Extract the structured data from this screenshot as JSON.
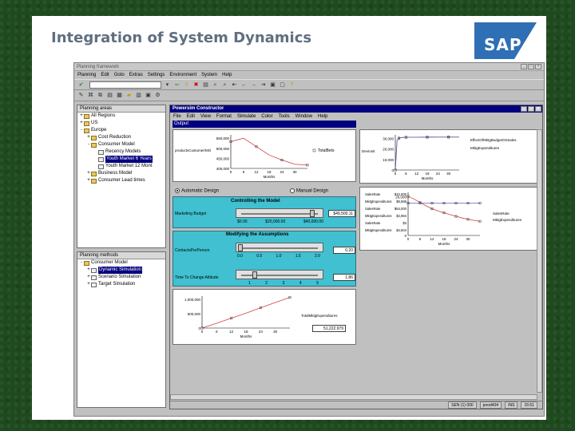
{
  "slide": {
    "title": "Integration of System Dynamics",
    "logo_text": "SAP",
    "colors": {
      "background": "#1f4a1f",
      "logo_blue": "#2f6fb5",
      "title_gray": "#5f6f7f"
    }
  },
  "app": {
    "window_title": "Planning framework",
    "menu": [
      "Planning",
      "Edit",
      "Goto",
      "Extras",
      "Settings",
      "Environment",
      "System",
      "Help"
    ],
    "left_top": {
      "header": "Planning areas",
      "items": [
        {
          "label": "All Regions",
          "level": 0,
          "exp": "+",
          "icon": "folder"
        },
        {
          "label": "US",
          "level": 0,
          "exp": "+",
          "icon": "folder"
        },
        {
          "label": "Europe",
          "level": 0,
          "exp": "-",
          "icon": "folder"
        },
        {
          "label": "Cost Reduction",
          "level": 1,
          "exp": "+",
          "icon": "folder"
        },
        {
          "label": "Consumer Model",
          "level": 1,
          "exp": "-",
          "icon": "folder"
        },
        {
          "label": "Recency Models",
          "level": 2,
          "exp": "",
          "icon": "doc"
        },
        {
          "label": "Youth Market 6 Years",
          "level": 2,
          "exp": "",
          "icon": "doc",
          "selected": true
        },
        {
          "label": "Youth Market 12 Mont",
          "level": 2,
          "exp": "",
          "icon": "doc"
        },
        {
          "label": "Business Model",
          "level": 1,
          "exp": "+",
          "icon": "folder"
        },
        {
          "label": "Consumer Lead times",
          "level": 1,
          "exp": "+",
          "icon": "folder"
        }
      ]
    },
    "left_bottom": {
      "header": "Planning methods",
      "items": [
        {
          "label": "Consumer Model",
          "level": 0,
          "exp": "-",
          "icon": "folder"
        },
        {
          "label": "Dynamic Simulation",
          "level": 1,
          "exp": "+",
          "icon": "doc",
          "selected": true
        },
        {
          "label": "Scenario Simulation",
          "level": 1,
          "exp": "+",
          "icon": "doc"
        },
        {
          "label": "Target Simulation",
          "level": 1,
          "exp": "+",
          "icon": "doc"
        }
      ]
    },
    "inner": {
      "title": "Powersim Constructor",
      "menu": [
        "File",
        "Edit",
        "View",
        "Format",
        "Simulate",
        "Color",
        "Tools",
        "Window",
        "Help"
      ],
      "output_label": "Output",
      "radio_auto": "Automatic Design",
      "radio_manual": "Manual Design",
      "controlling_title": "Controlling the Model",
      "control_param_label": "Marketing Budget",
      "control_ticks": [
        "$0.00",
        "$20,000.00",
        "$40,000.00"
      ],
      "control_value": "$49,500.11",
      "assumptions_title": "Modifying the Assumptions",
      "assump1_label": "ContactsPerPerson",
      "assump1_ticks": [
        "0.0",
        "0.5",
        "1.0",
        "1.5",
        "2.0"
      ],
      "assump1_value": "0.20",
      "assump2_label": "Time To Change Attitude",
      "assump2_ticks": [
        "1",
        "2",
        "3",
        "4",
        "5"
      ],
      "assump2_value": "1.86",
      "bottom_chart_value": "51,222.979"
    },
    "statusbar": [
      "SEN (1) 000",
      "pnod404",
      "INS",
      "15:51"
    ]
  },
  "chart_data": [
    {
      "type": "line",
      "title": "",
      "xlabel": "Months",
      "ylabel": "productsCustomer/MO",
      "x": [
        0,
        6,
        12,
        18,
        24,
        30,
        36
      ],
      "series": [
        {
          "name": "TotalBets",
          "values": [
            540000,
            560000,
            510000,
            460000,
            430000,
            405000,
            400000
          ]
        }
      ],
      "y_ticks": [
        "400,000",
        "450,000",
        "500,000",
        "550,000"
      ],
      "x_ticks": [
        "0",
        "6",
        "12",
        "18",
        "24",
        "30"
      ],
      "ylim": [
        380000,
        580000
      ]
    },
    {
      "type": "line",
      "title": "",
      "xlabel": "Months",
      "ylabel": "Dev/unit",
      "x": [
        0,
        1,
        2,
        3,
        6,
        12,
        18,
        24,
        30,
        36
      ],
      "series": [
        {
          "name": "EffectOfMktgBudgetOnSales",
          "values": [
            0,
            27000,
            29000,
            29500,
            29800,
            29900,
            29950,
            30000,
            30000,
            30000
          ]
        },
        {
          "name": "MktgExpenditures",
          "values": [
            0,
            27000,
            29000,
            29500,
            29800,
            29900,
            29950,
            30000,
            30000,
            30000
          ]
        }
      ],
      "y_ticks": [
        "0",
        "10,000",
        "20,000",
        "30,000"
      ],
      "x_ticks": [
        "0",
        "6",
        "12",
        "18",
        "24",
        "30"
      ],
      "ylim": [
        0,
        32000
      ]
    },
    {
      "type": "line",
      "title": "",
      "xlabel": "Months",
      "ylabel": "",
      "x": [
        0,
        3,
        6,
        9,
        12,
        15,
        18,
        21,
        24,
        27,
        30,
        33,
        36
      ],
      "series": [
        {
          "name": "SalesRate",
          "values": [
            29000,
            27000,
            24500,
            22000,
            19800,
            18200,
            16800,
            15500,
            14200,
            13000,
            12000,
            11200,
            10500
          ]
        },
        {
          "name": "MktgExpenditures",
          "values": [
            24000,
            24000,
            24000,
            24000,
            24000,
            24000,
            24000,
            24000,
            24000,
            24000,
            24000,
            24000,
            24000
          ]
        }
      ],
      "y_ticks": [
        "0",
        "20,000"
      ],
      "x_ticks": [
        "0",
        "6",
        "12",
        "18",
        "24",
        "30"
      ],
      "legend_rows": [
        "SalesRate",
        "MktgExpenditures",
        "SalesRate",
        "MktgExpenditures",
        "SalesRate",
        "MktgExpenditures"
      ],
      "legend_values": [
        "$10,000",
        "$9,888",
        "$64,000",
        "$4,984",
        "$3",
        "$4,604"
      ],
      "ylim": [
        0,
        32000
      ]
    },
    {
      "type": "line",
      "title": "",
      "xlabel": "Months",
      "ylabel": "",
      "x": [
        0,
        6,
        12,
        18,
        24,
        30,
        36
      ],
      "series": [
        {
          "name": "TotalMktgExpenditures",
          "values": [
            0,
            180000,
            370000,
            560000,
            760000,
            960000,
            1150000
          ]
        }
      ],
      "y_ticks": [
        "0",
        "500,000",
        "1,000,000"
      ],
      "x_ticks": [
        "0",
        "6",
        "12",
        "18",
        "24",
        "30"
      ],
      "ylim": [
        0,
        1200000
      ]
    }
  ]
}
